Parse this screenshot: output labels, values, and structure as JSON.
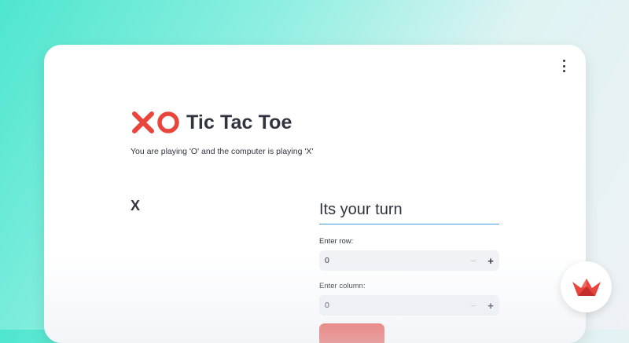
{
  "app": {
    "title": "Tic Tac Toe",
    "subtitle": "You are playing 'O' and the computer is playing 'X'",
    "logo_icons": [
      "cross-mark-icon",
      "hollow-circle-icon"
    ]
  },
  "board": {
    "cell_mark": "X"
  },
  "turn": {
    "heading": "Its your turn",
    "row": {
      "label": "Enter row:",
      "value": "0",
      "decrement": "−",
      "increment": "+"
    },
    "column": {
      "label": "Enter column:",
      "value": "0",
      "decrement": "−",
      "increment": "+"
    }
  },
  "colors": {
    "accent_red": "#e8453c",
    "text": "#31333f",
    "heading_underline": "#4a9ee8",
    "input_bg": "#f0f2f6"
  },
  "icons": {
    "menu": "kebab-menu-icon",
    "brand": "crown-icon"
  }
}
